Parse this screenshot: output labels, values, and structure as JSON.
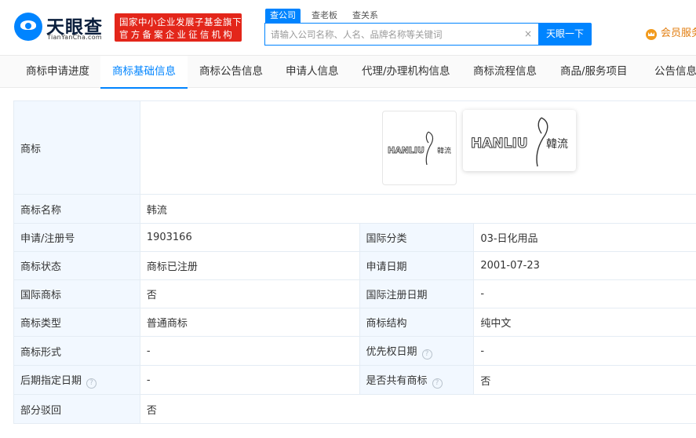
{
  "header": {
    "logo_cn": "天眼查",
    "logo_en": "TianYanCha.com",
    "badge_line1": "国家中小企业发展子基金旗下",
    "badge_line2": "官方备案企业征信机构",
    "search_tabs": [
      "查公司",
      "查老板",
      "查关系"
    ],
    "search_placeholder": "请输入公司名称、人名、品牌名称等关键词",
    "search_button": "天眼一下",
    "vip_label": "会员服务"
  },
  "nav": {
    "tabs": [
      "商标申请进度",
      "商标基础信息",
      "商标公告信息",
      "申请人信息",
      "代理/办理机构信息",
      "商标流程信息",
      "商品/服务项目",
      "公告信息"
    ],
    "active_index": 1
  },
  "trademark": {
    "image_label": "商标",
    "logo_text_latin": "HANLIU",
    "logo_text_cn": "韓流",
    "rows": [
      {
        "label": "商标名称",
        "value": "韩流"
      },
      {
        "label": "申请/注册号",
        "value": "1903166",
        "label2": "国际分类",
        "value2": "03-日化用品"
      },
      {
        "label": "商标状态",
        "value": "商标已注册",
        "label2": "申请日期",
        "value2": "2001-07-23"
      },
      {
        "label": "国际商标",
        "value": "否",
        "label2": "国际注册日期",
        "value2": "-"
      },
      {
        "label": "商标类型",
        "value": "普通商标",
        "label2": "商标结构",
        "value2": "纯中文"
      },
      {
        "label": "商标形式",
        "value": "-",
        "label2": "优先权日期",
        "value2": "-"
      },
      {
        "label": "后期指定日期",
        "value": "-",
        "label2": "是否共有商标",
        "value2": "否"
      },
      {
        "label": "部分驳回",
        "value": "否"
      }
    ]
  },
  "colors": {
    "brand_blue": "#0084ff",
    "badge_red": "#e3261a",
    "vip_orange": "#e27d0f",
    "label_bg": "#f2f8ff"
  }
}
